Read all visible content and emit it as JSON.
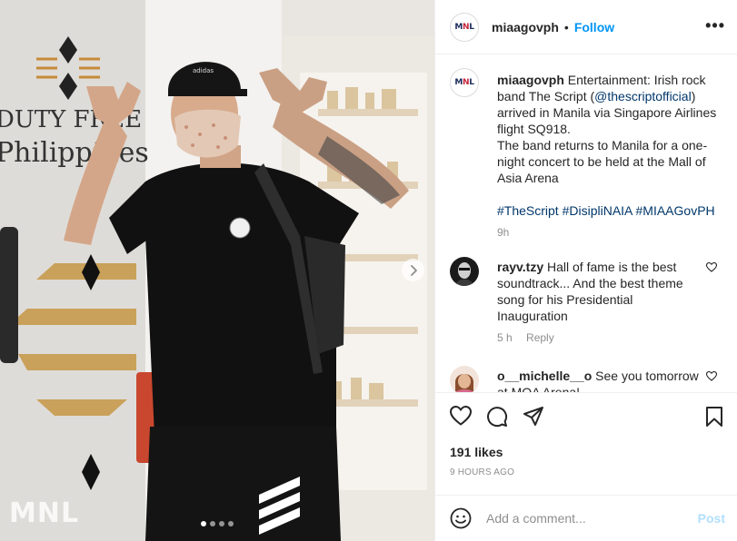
{
  "post": {
    "username": "miaagovph",
    "separator": "•",
    "follow_label": "Follow",
    "more_icon_text": "•••",
    "avatar_text": {
      "m": "M",
      "n": "N",
      "l": "L"
    },
    "caption": {
      "part1": "Entertainment: Irish rock band The Script (",
      "mention": "@thescriptofficial",
      "part2": ") arrived in Manila via Singapore Airlines flight SQ918.",
      "part3": "The band returns to Manila for a one-night concert to be held at the Mall of Asia Arena",
      "hashtags": "#TheScript #DisipliNAIA #MIAAGovPH",
      "time": "9h"
    },
    "comments": [
      {
        "username": "rayv.tzy",
        "text": "Hall of fame is the best soundtrack... And the best theme song for his Presidential Inauguration",
        "time": "5 h",
        "reply_label": "Reply"
      },
      {
        "username": "o__michelle__o",
        "text": "See you tomorrow at MOA Arena!",
        "time": "",
        "reply_label": ""
      }
    ],
    "likes": "191 likes",
    "ago": "9 HOURS AGO",
    "add_comment_placeholder": "Add a comment...",
    "post_label": "Post"
  },
  "photo": {
    "watermark": "MNL",
    "carousel_count": 4,
    "carousel_active": 1,
    "sign_text": {
      "line1": "DUTY FREE",
      "line2": "Philippines"
    }
  },
  "icons": {
    "next": "chevron-right-icon",
    "heart": "heart-icon",
    "comment": "comment-icon",
    "share": "share-icon",
    "save": "bookmark-icon",
    "emoji": "emoji-icon",
    "more": "more-icon"
  },
  "colors": {
    "link": "#00376b",
    "follow": "#0095f6",
    "post_disabled": "#b2dffc",
    "muted": "#8e8e8e"
  }
}
